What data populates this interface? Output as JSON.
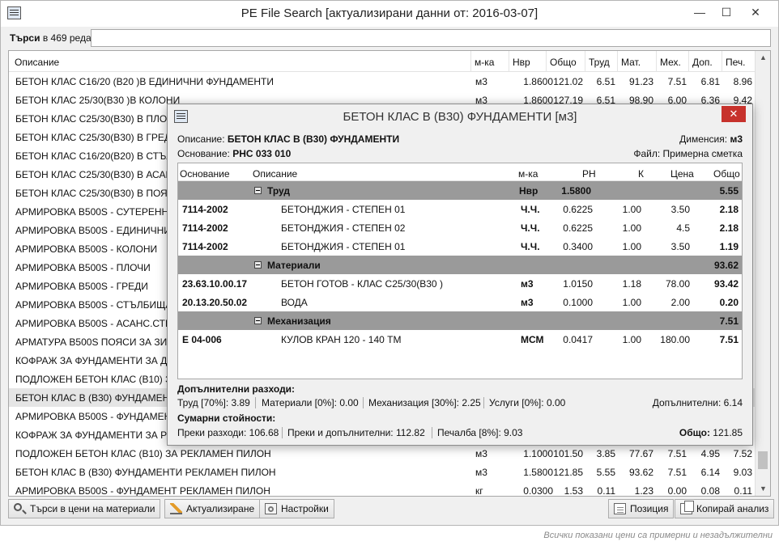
{
  "window": {
    "title": "PE File Search [актуализирани данни от: 2016-03-07]",
    "minimize": "—",
    "maximize": "☐",
    "close": "✕"
  },
  "search": {
    "label_bold": "Търси",
    "label_rest": "в 469 реда:",
    "value": ""
  },
  "columns": {
    "desc": "Описание",
    "unit": "м-ка",
    "nvr": "Нвр",
    "total": "Общо",
    "labor": "Труд",
    "mat": "Мат.",
    "mech": "Мех.",
    "add": "Доп.",
    "profit": "Печ."
  },
  "rows": [
    {
      "desc": "БЕТОН КЛАС С16/20 (В20 )В ЕДИНИЧНИ ФУНДАМЕНТИ",
      "unit": "м3",
      "nvr": "1.8600",
      "total": "121.02",
      "labor": "6.51",
      "mat": "91.23",
      "mech": "7.51",
      "add": "6.81",
      "profit": "8.96"
    },
    {
      "desc": "БЕТОН КЛАС  25/30(В30 )В КОЛОНИ",
      "unit": "м3",
      "nvr": "1.8600",
      "total": "127.19",
      "labor": "6.51",
      "mat": "98.90",
      "mech": "6.00",
      "add": "6.36",
      "profit": "9.42"
    },
    {
      "desc": "БЕТОН КЛАС С25/30(В30) В ПЛОЧИ",
      "unit": "",
      "nvr": "",
      "total": "",
      "labor": "",
      "mat": "",
      "mech": "",
      "add": "",
      "profit": ""
    },
    {
      "desc": "БЕТОН КЛАС  С25/30(В30) В ГРЕДИ",
      "unit": "",
      "nvr": "",
      "total": "",
      "labor": "",
      "mat": "",
      "mech": "",
      "add": "",
      "profit": ""
    },
    {
      "desc": "БЕТОН КЛАС  С16/20(В20) В СТЪЛБИ",
      "unit": "",
      "nvr": "",
      "total": "",
      "labor": "",
      "mat": "",
      "mech": "",
      "add": "",
      "profit": ""
    },
    {
      "desc": "БЕТОН КЛАС  С25/30(В30) В АСАНСЬОР",
      "unit": "",
      "nvr": "",
      "total": "",
      "labor": "",
      "mat": "",
      "mech": "",
      "add": "",
      "profit": ""
    },
    {
      "desc": "БЕТОН КЛАС  С25/30(В30) В ПОЯСИ",
      "unit": "",
      "nvr": "",
      "total": "",
      "labor": "",
      "mat": "",
      "mech": "",
      "add": "",
      "profit": ""
    },
    {
      "desc": "АРМИРОВКА  В500S  - СУТЕРЕННИ",
      "unit": "",
      "nvr": "",
      "total": "",
      "labor": "",
      "mat": "",
      "mech": "",
      "add": "",
      "profit": ""
    },
    {
      "desc": "АРМИРОВКА  В500S  - ЕДИНИЧНИ",
      "unit": "",
      "nvr": "",
      "total": "",
      "labor": "",
      "mat": "",
      "mech": "",
      "add": "",
      "profit": ""
    },
    {
      "desc": "АРМИРОВКА  В500S  - КОЛОНИ",
      "unit": "",
      "nvr": "",
      "total": "",
      "labor": "",
      "mat": "",
      "mech": "",
      "add": "",
      "profit": ""
    },
    {
      "desc": "АРМИРОВКА  В500S  - ПЛОЧИ",
      "unit": "",
      "nvr": "",
      "total": "",
      "labor": "",
      "mat": "",
      "mech": "",
      "add": "",
      "profit": ""
    },
    {
      "desc": "АРМИРОВКА  В500S  - ГРЕДИ",
      "unit": "",
      "nvr": "",
      "total": "",
      "labor": "",
      "mat": "",
      "mech": "",
      "add": "",
      "profit": ""
    },
    {
      "desc": "АРМИРОВКА  В500S  - СТЪЛБИЩА",
      "unit": "",
      "nvr": "",
      "total": "",
      "labor": "",
      "mat": "",
      "mech": "",
      "add": "",
      "profit": ""
    },
    {
      "desc": "АРМИРОВКА  В500S  - АСАНС.СТЕНИ",
      "unit": "",
      "nvr": "",
      "total": "",
      "labor": "",
      "mat": "",
      "mech": "",
      "add": "",
      "profit": ""
    },
    {
      "desc": "АРМАТУРА  В500S  ПОЯСИ ЗА ЗИДА",
      "unit": "",
      "nvr": "",
      "total": "",
      "labor": "",
      "mat": "",
      "mech": "",
      "add": "",
      "profit": ""
    },
    {
      "desc": "КОФРАЖ ЗА   ФУНДАМЕНТИ ЗА Д",
      "unit": "",
      "nvr": "",
      "total": "",
      "labor": "",
      "mat": "",
      "mech": "",
      "add": "",
      "profit": ""
    },
    {
      "desc": "ПОДЛОЖЕН  БЕТОН КЛАС (В10)  З",
      "unit": "",
      "nvr": "",
      "total": "",
      "labor": "",
      "mat": "",
      "mech": "",
      "add": "",
      "profit": ""
    },
    {
      "desc": "БЕТОН КЛАС В (В30)  ФУНДАМЕНТ",
      "unit": "",
      "nvr": "",
      "total": "",
      "labor": "",
      "mat": "",
      "mech": "",
      "add": "",
      "profit": ""
    },
    {
      "desc": "АРМИРОВКА  В500S  - ФУНДАМЕНТ",
      "unit": "",
      "nvr": "",
      "total": "",
      "labor": "",
      "mat": "",
      "mech": "",
      "add": "",
      "profit": ""
    },
    {
      "desc": "КОФРАЖ ЗА   ФУНДАМЕНТИ ЗА Р",
      "unit": "",
      "nvr": "",
      "total": "",
      "labor": "",
      "mat": "",
      "mech": "",
      "add": "",
      "profit": ""
    },
    {
      "desc": "ПОДЛОЖЕН  БЕТОН КЛАС (В10) ЗА РЕКЛАМЕН ПИЛОН",
      "unit": "м3",
      "nvr": "1.1000",
      "total": "101.50",
      "labor": "3.85",
      "mat": "77.67",
      "mech": "7.51",
      "add": "4.95",
      "profit": "7.52"
    },
    {
      "desc": "БЕТОН КЛАС В (В30)  ФУНДАМЕНТИ  РЕКЛАМЕН ПИЛОН",
      "unit": "м3",
      "nvr": "1.5800",
      "total": "121.85",
      "labor": "5.55",
      "mat": "93.62",
      "mech": "7.51",
      "add": "6.14",
      "profit": "9.03"
    },
    {
      "desc": "АРМИРОВКА  В500S - ФУНДАМЕНТ РЕКЛАМЕН ПИЛОН",
      "unit": "кг",
      "nvr": "0.0300",
      "total": "1.53",
      "labor": "0.11",
      "mat": "1.23",
      "mech": "0.00",
      "add": "0.08",
      "profit": "0.11"
    }
  ],
  "buttons": {
    "search_materials": "Търси в цени на материали",
    "update": "Актуализиране",
    "settings": "Настройки",
    "position": "Позиция",
    "copy_analysis": "Копирай анализ"
  },
  "footer_note": "Всички показани цени са примерни и незадължителни",
  "dialog": {
    "title": "БЕТОН КЛАС В (В30)  ФУНДАМЕНТИ   [м3]",
    "close": "✕",
    "desc_label": "Описание:",
    "desc_value": "БЕТОН КЛАС В (В30)  ФУНДАМЕНТИ",
    "dim_label": "Дименсия:",
    "dim_value": "м3",
    "basis_label": "Основание:",
    "basis_value": "РНС 033 010",
    "file_label": "Файл:",
    "file_value": "Примерна сметка",
    "cols": {
      "basis": "Основание",
      "desc": "Описание",
      "unit": "м-ка",
      "rn": "РН",
      "k": "К",
      "price": "Цена",
      "total": "Общо"
    },
    "groups": [
      {
        "name": "Труд",
        "unit": "Нвр",
        "rn": "1.5800",
        "total": "5.55",
        "items": [
          {
            "basis": "7114-2002",
            "desc": "БЕТОНДЖИЯ - СТЕПЕН 01",
            "unit": "Ч.Ч.",
            "rn": "0.6225",
            "k": "1.00",
            "price": "3.50",
            "total": "2.18"
          },
          {
            "basis": "7114-2002",
            "desc": "БЕТОНДЖИЯ - СТЕПЕН 02",
            "unit": "Ч.Ч.",
            "rn": "0.6225",
            "k": "1.00",
            "price": "4.5",
            "total": "2.18"
          },
          {
            "basis": "7114-2002",
            "desc": "БЕТОНДЖИЯ - СТЕПЕН 01",
            "unit": "Ч.Ч.",
            "rn": "0.3400",
            "k": "1.00",
            "price": "3.50",
            "total": "1.19"
          }
        ]
      },
      {
        "name": "Материали",
        "unit": "",
        "rn": "",
        "total": "93.62",
        "items": [
          {
            "basis": "23.63.10.00.17",
            "desc": "БЕТОН ГОТОВ - КЛАС С25/30(В30 )",
            "unit": "м3",
            "rn": "1.0150",
            "k": "1.18",
            "price": "78.00",
            "total": "93.42"
          },
          {
            "basis": "20.13.20.50.02",
            "desc": "ВОДА",
            "unit": "м3",
            "rn": "0.1000",
            "k": "1.00",
            "price": "2.00",
            "total": "0.20"
          }
        ]
      },
      {
        "name": "Механизация",
        "unit": "",
        "rn": "",
        "total": "7.51",
        "items": [
          {
            "basis": "Е 04-006",
            "desc": "КУЛОВ КРАН 120 - 140 ТМ",
            "unit": "МСМ",
            "rn": "0.0417",
            "k": "1.00",
            "price": "180.00",
            "total": "7.51"
          }
        ]
      }
    ],
    "extra": {
      "heading": "Допълнителни разходи:",
      "labor_label": "Труд [70%]:",
      "labor_value": "3.89",
      "mat_label": "Материали [0%]:",
      "mat_value": "0.00",
      "mech_label": "Механизация [30%]:",
      "mech_value": "2.25",
      "serv_label": "Услуги [0%]:",
      "serv_value": "0.00",
      "add_label": "Допълнителни:",
      "add_value": "6.14"
    },
    "totals": {
      "heading": "Сумарни стойности:",
      "direct_label": "Преки разходи:",
      "direct_value": "106.68",
      "direct_add_label": "Преки и допълнителни:",
      "direct_add_value": "112.82",
      "profit_label": "Печалба [8%]:",
      "profit_value": "9.03",
      "total_label": "Общо:",
      "total_value": "121.85"
    }
  }
}
